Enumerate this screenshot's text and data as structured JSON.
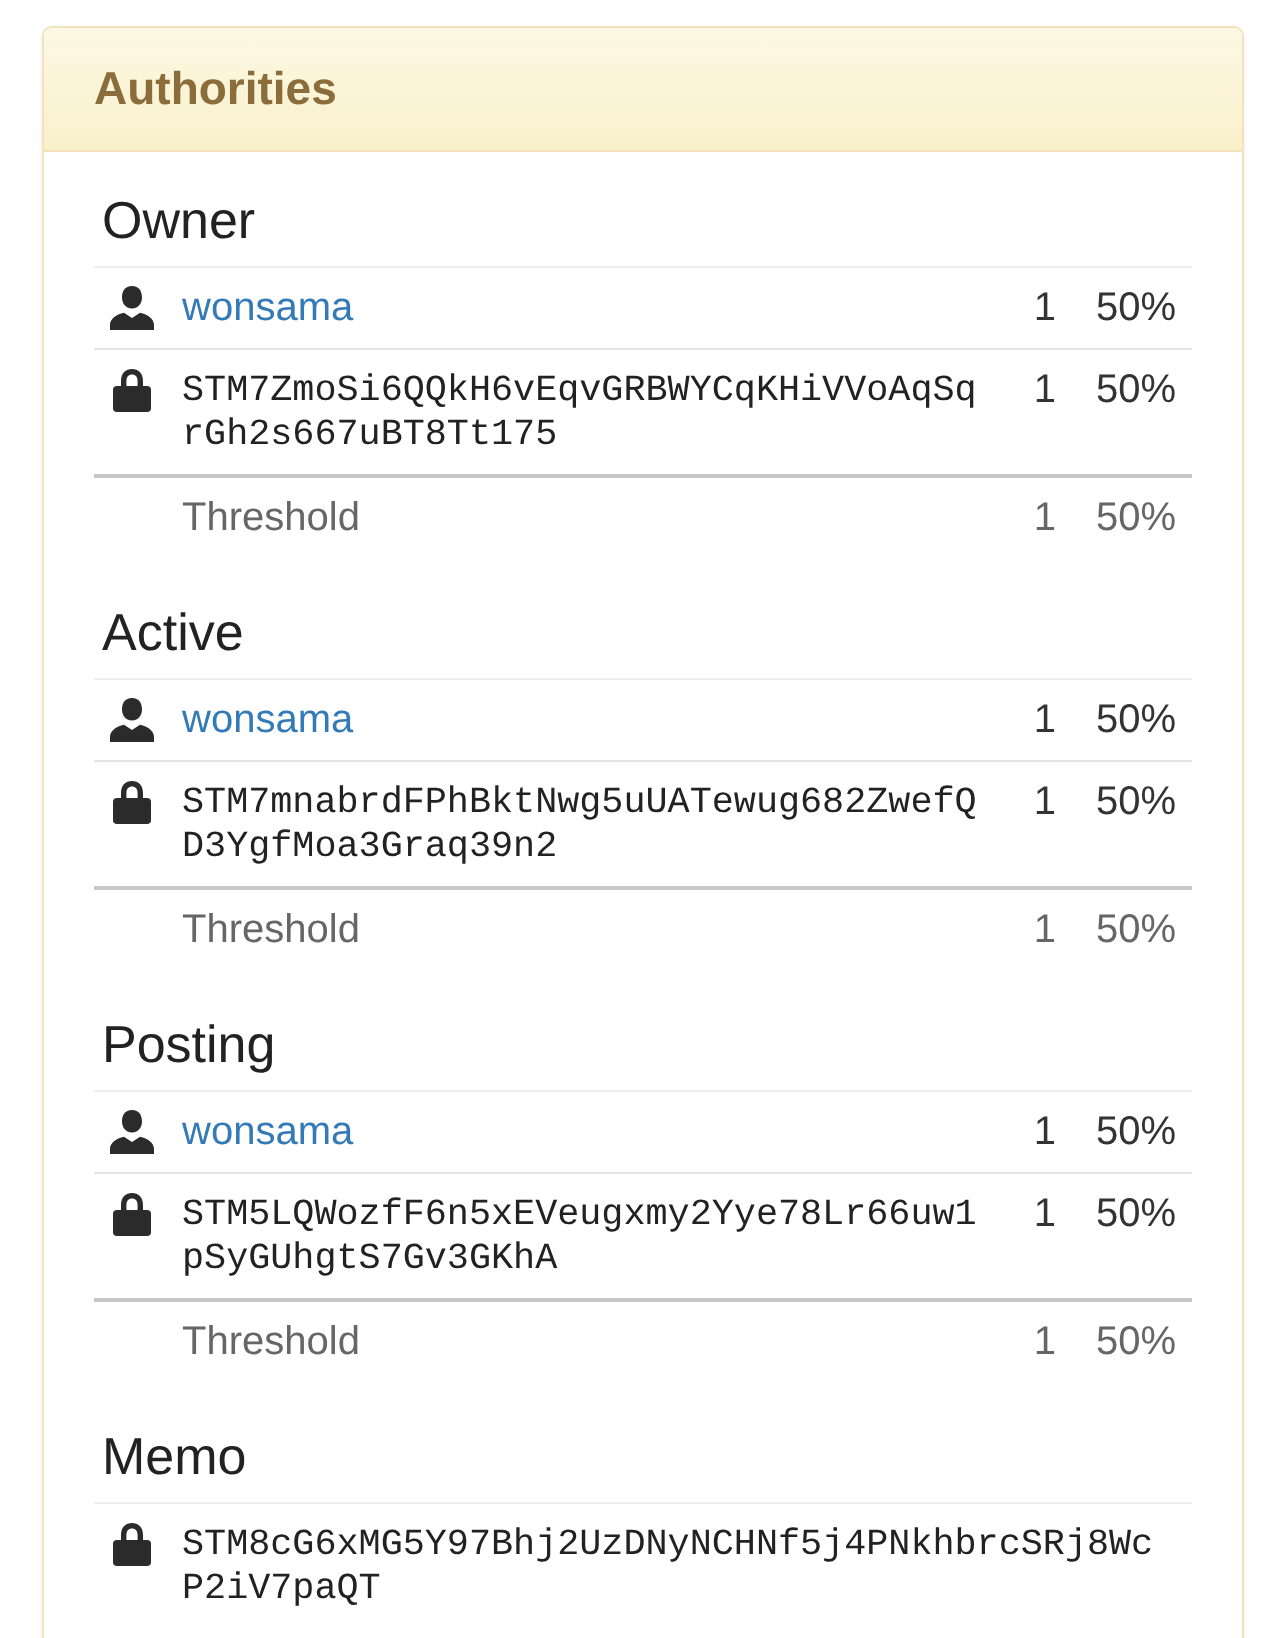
{
  "panel": {
    "title": "Authorities"
  },
  "sections": [
    {
      "title": "Owner",
      "rows": [
        {
          "kind": "account",
          "name": "wonsama",
          "weight": "1",
          "percent": "50%"
        },
        {
          "kind": "key",
          "key": "STM7ZmoSi6QQkH6vEqvGRBWYCqKHiVVoAqSqrGh2s667uBT8Tt175",
          "weight": "1",
          "percent": "50%"
        },
        {
          "kind": "threshold",
          "label": "Threshold",
          "weight": "1",
          "percent": "50%"
        }
      ]
    },
    {
      "title": "Active",
      "rows": [
        {
          "kind": "account",
          "name": "wonsama",
          "weight": "1",
          "percent": "50%"
        },
        {
          "kind": "key",
          "key": "STM7mnabrdFPhBktNwg5uUATewug682ZwefQD3YgfMoa3Graq39n2",
          "weight": "1",
          "percent": "50%"
        },
        {
          "kind": "threshold",
          "label": "Threshold",
          "weight": "1",
          "percent": "50%"
        }
      ]
    },
    {
      "title": "Posting",
      "rows": [
        {
          "kind": "account",
          "name": "wonsama",
          "weight": "1",
          "percent": "50%"
        },
        {
          "kind": "key",
          "key": "STM5LQWozfF6n5xEVeugxmy2Yye78Lr66uw1pSyGUhgtS7Gv3GKhA",
          "weight": "1",
          "percent": "50%"
        },
        {
          "kind": "threshold",
          "label": "Threshold",
          "weight": "1",
          "percent": "50%"
        }
      ]
    },
    {
      "title": "Memo",
      "rows": [
        {
          "kind": "key",
          "key": "STM8cG6xMG5Y97Bhj2UzDNyNCHNf5j4PNkhbrcSRj8WcP2iV7paQT"
        }
      ]
    }
  ]
}
